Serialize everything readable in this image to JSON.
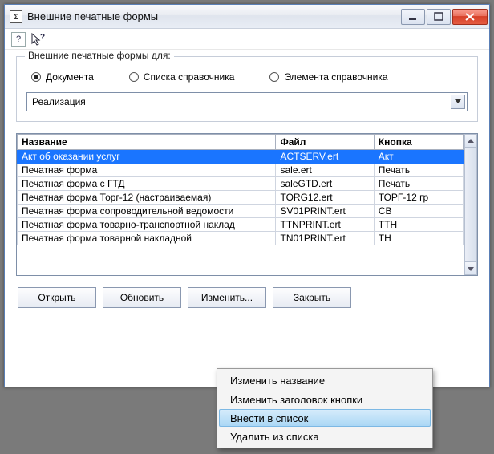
{
  "window": {
    "title": "Внешние печатные формы"
  },
  "groupbox": {
    "legend": "Внешние печатные формы для:",
    "radios": [
      {
        "label": "Документа",
        "checked": true
      },
      {
        "label": "Списка справочника",
        "checked": false
      },
      {
        "label": "Элемента справочника",
        "checked": false
      }
    ],
    "combo_value": "Реализация"
  },
  "table": {
    "headers": [
      "Название",
      "Файл",
      "Кнопка"
    ],
    "rows": [
      {
        "cells": [
          "Акт об оказании услуг",
          "ACTSERV.ert",
          "Акт"
        ],
        "selected": true
      },
      {
        "cells": [
          "Печатная форма",
          "sale.ert",
          "Печать"
        ],
        "selected": false
      },
      {
        "cells": [
          "Печатная форма с ГТД",
          "saleGTD.ert",
          "Печать"
        ],
        "selected": false
      },
      {
        "cells": [
          "Печатная форма Торг-12 (настраиваемая)",
          "TORG12.ert",
          "ТОРГ-12 гр"
        ],
        "selected": false
      },
      {
        "cells": [
          "Печатная форма сопроводительной ведомости",
          "SV01PRINT.ert",
          "СВ"
        ],
        "selected": false
      },
      {
        "cells": [
          "Печатная форма товарно-транспортной наклад",
          "TTNPRINT.ert",
          "ТТН"
        ],
        "selected": false
      },
      {
        "cells": [
          "Печатная форма товарной накладной",
          "TN01PRINT.ert",
          "ТН"
        ],
        "selected": false
      }
    ]
  },
  "buttons": {
    "open": "Открыть",
    "refresh": "Обновить",
    "change": "Изменить...",
    "close": "Закрыть"
  },
  "menu": {
    "items": [
      {
        "label": "Изменить название",
        "hover": false
      },
      {
        "label": "Изменить заголовок кнопки",
        "hover": false
      },
      {
        "label": "Внести в список",
        "hover": true
      },
      {
        "label": "Удалить из списка",
        "hover": false
      }
    ]
  }
}
